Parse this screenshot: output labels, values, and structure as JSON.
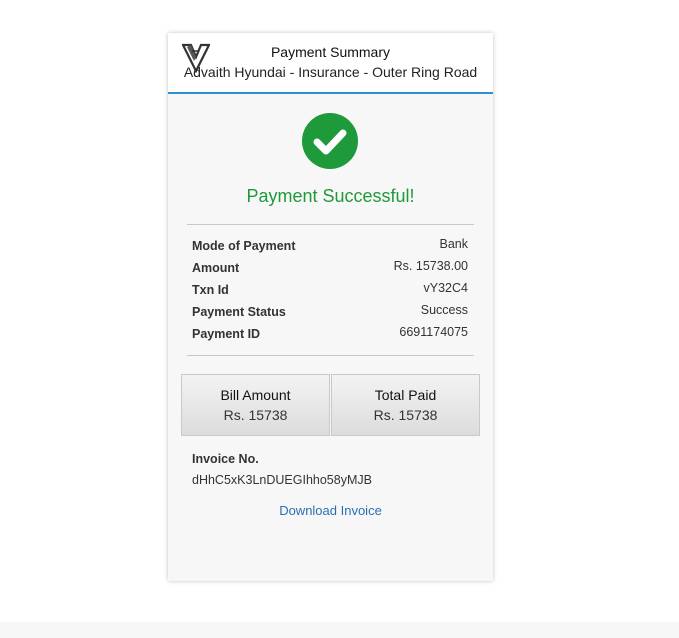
{
  "header": {
    "title": "Payment Summary",
    "subtitle": "Advaith Hyundai - Insurance - Outer Ring Road",
    "accent_color": "#2e8fcf",
    "logo_icon": "hyundai-v-logo-icon"
  },
  "status": {
    "icon": "check-circle-icon",
    "message": "Payment Successful!",
    "color": "#1f9a3a"
  },
  "details": [
    {
      "label": "Mode of Payment",
      "value": "Bank"
    },
    {
      "label": "Amount",
      "value": "Rs. 15738.00"
    },
    {
      "label": "Txn Id",
      "value": "vY32C4"
    },
    {
      "label": "Payment Status",
      "value": "Success"
    },
    {
      "label": "Payment ID",
      "value": "6691174075"
    }
  ],
  "summary": {
    "bill_amount_label": "Bill Amount",
    "bill_amount_value": "Rs. 15738",
    "total_paid_label": "Total Paid",
    "total_paid_value": "Rs. 15738"
  },
  "invoice": {
    "label": "Invoice No.",
    "value": "dHhC5xK3LnDUEGIhho58yMJB",
    "download_label": "Download Invoice",
    "link_color": "#2a6fb5"
  }
}
